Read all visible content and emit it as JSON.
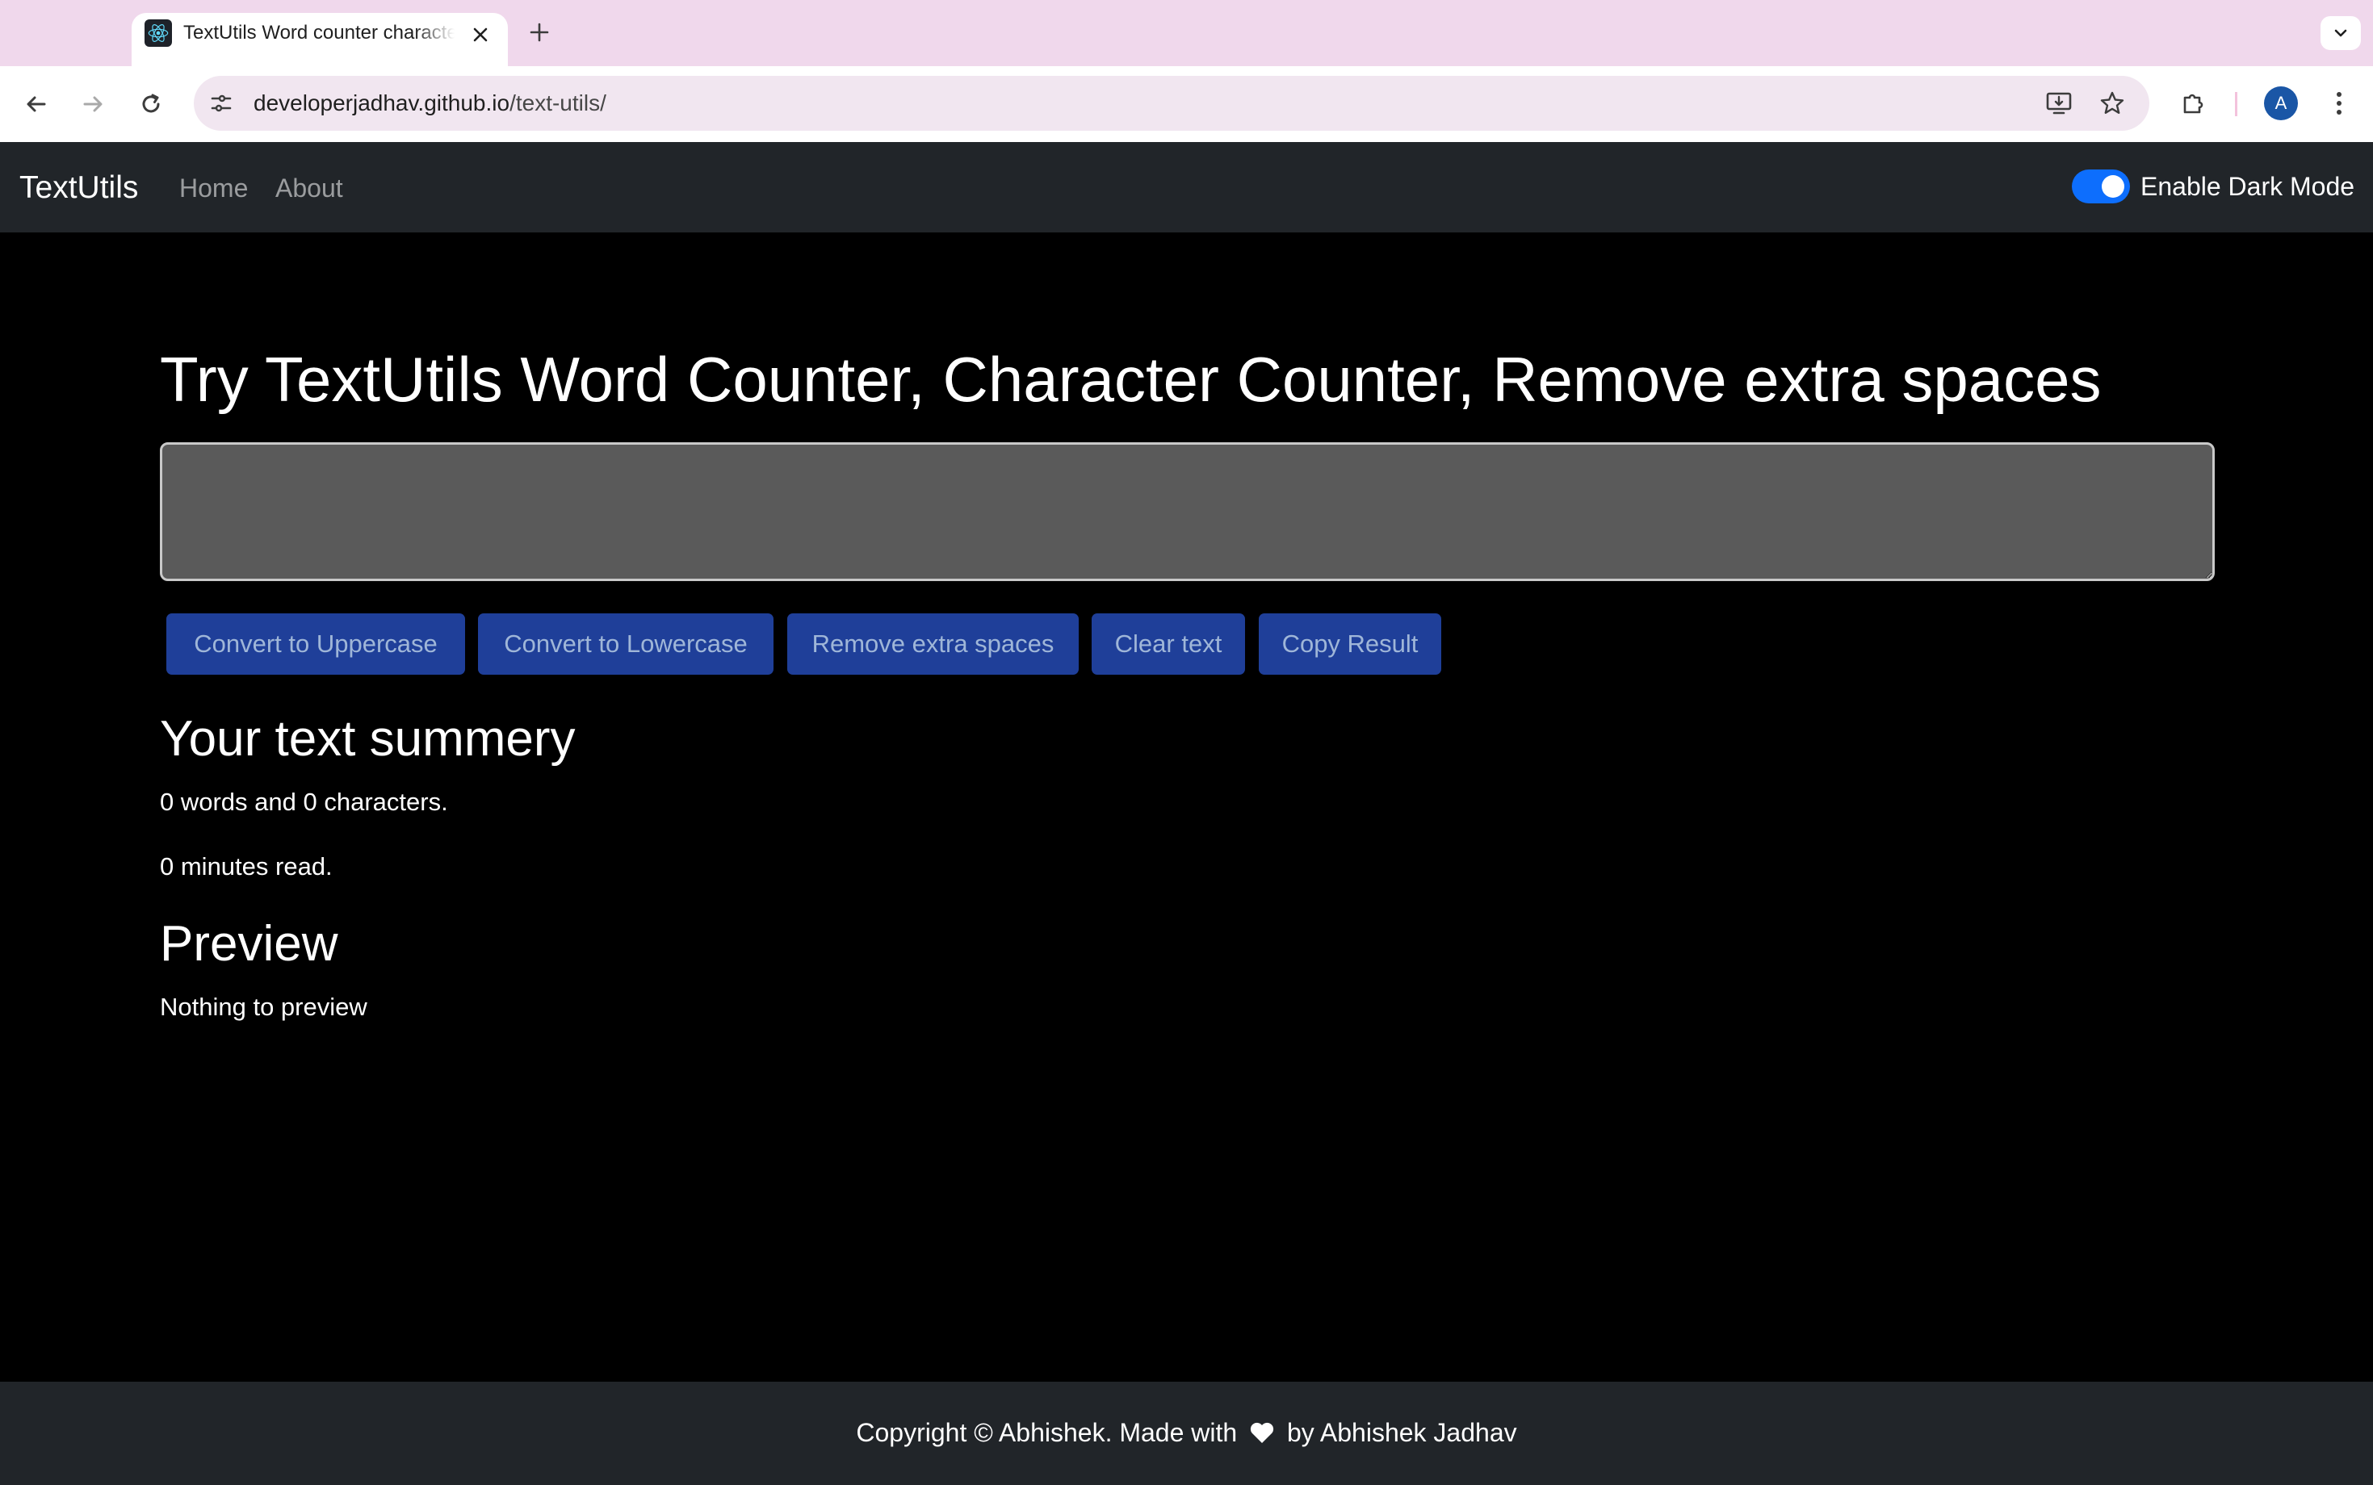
{
  "browser": {
    "tab_title": "TextUtils Word counter character counter",
    "url_domain": "developerjadhav.github.io",
    "url_path": "/text-utils/",
    "profile_initial": "A",
    "icons": {
      "favicon": "react-logo-icon",
      "close": "close-icon",
      "new_tab": "plus-icon",
      "tab_search": "chevron-down-icon",
      "back": "arrow-left-icon",
      "forward": "arrow-right-icon",
      "reload": "reload-icon",
      "site_info": "tune-icon",
      "install": "install-app-icon",
      "bookmark": "star-icon",
      "extensions": "puzzle-icon",
      "menu": "kebab-menu-icon"
    }
  },
  "navbar": {
    "brand": "TextUtils",
    "links": [
      "Home",
      "About"
    ],
    "dark_mode_label": "Enable Dark Mode",
    "dark_mode_enabled": true
  },
  "main": {
    "heading": "Try TextUtils Word Counter, Character Counter, Remove extra spaces",
    "textarea_value": "",
    "buttons": [
      "Convert to Uppercase",
      "Convert to Lowercase",
      "Remove extra spaces",
      "Clear text",
      "Copy Result"
    ],
    "summary_heading": "Your text summery",
    "summary_counts": "0 words and 0 characters.",
    "read_time": "0 minutes read.",
    "preview_heading": "Preview",
    "preview_text": "Nothing to preview"
  },
  "footer": {
    "text_before": "Copyright © Abhishek. Made with",
    "text_after": "by Abhishek Jadhav",
    "icon": "heart-icon"
  },
  "colors": {
    "page_background": "#000000",
    "navbar_background": "#212529",
    "button_background": "#1f3f99",
    "switch_on": "#0d6efd",
    "textarea_background": "#5a5a5a",
    "tabstrip_background": "#f0d8ec"
  }
}
